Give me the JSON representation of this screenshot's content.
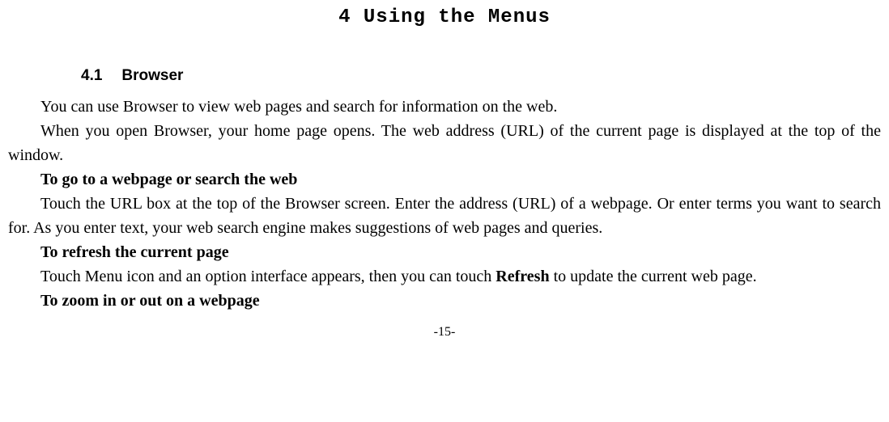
{
  "chapter": {
    "title": "4 Using the Menus"
  },
  "section": {
    "number": "4.1",
    "title": "Browser"
  },
  "body": {
    "p1": "You can use Browser to view web pages and search for information on the web.",
    "p2": "When you open Browser, your home page opens. The web address (URL) of the current page is displayed at the top of the window.",
    "h1": "To go to a webpage or search the web",
    "p3": "Touch the URL box at the top of the Browser screen. Enter the address (URL) of a webpage. Or enter terms you want to search for. As you enter text, your web search engine makes suggestions of web pages and queries.",
    "h2": "To refresh the current page",
    "p4a": "Touch Menu icon and an option interface appears, then you can touch ",
    "p4b": "Refresh",
    "p4c": " to update the current web page.",
    "h3": "To zoom in or out on a webpage"
  },
  "footer": {
    "page": "-15-"
  }
}
